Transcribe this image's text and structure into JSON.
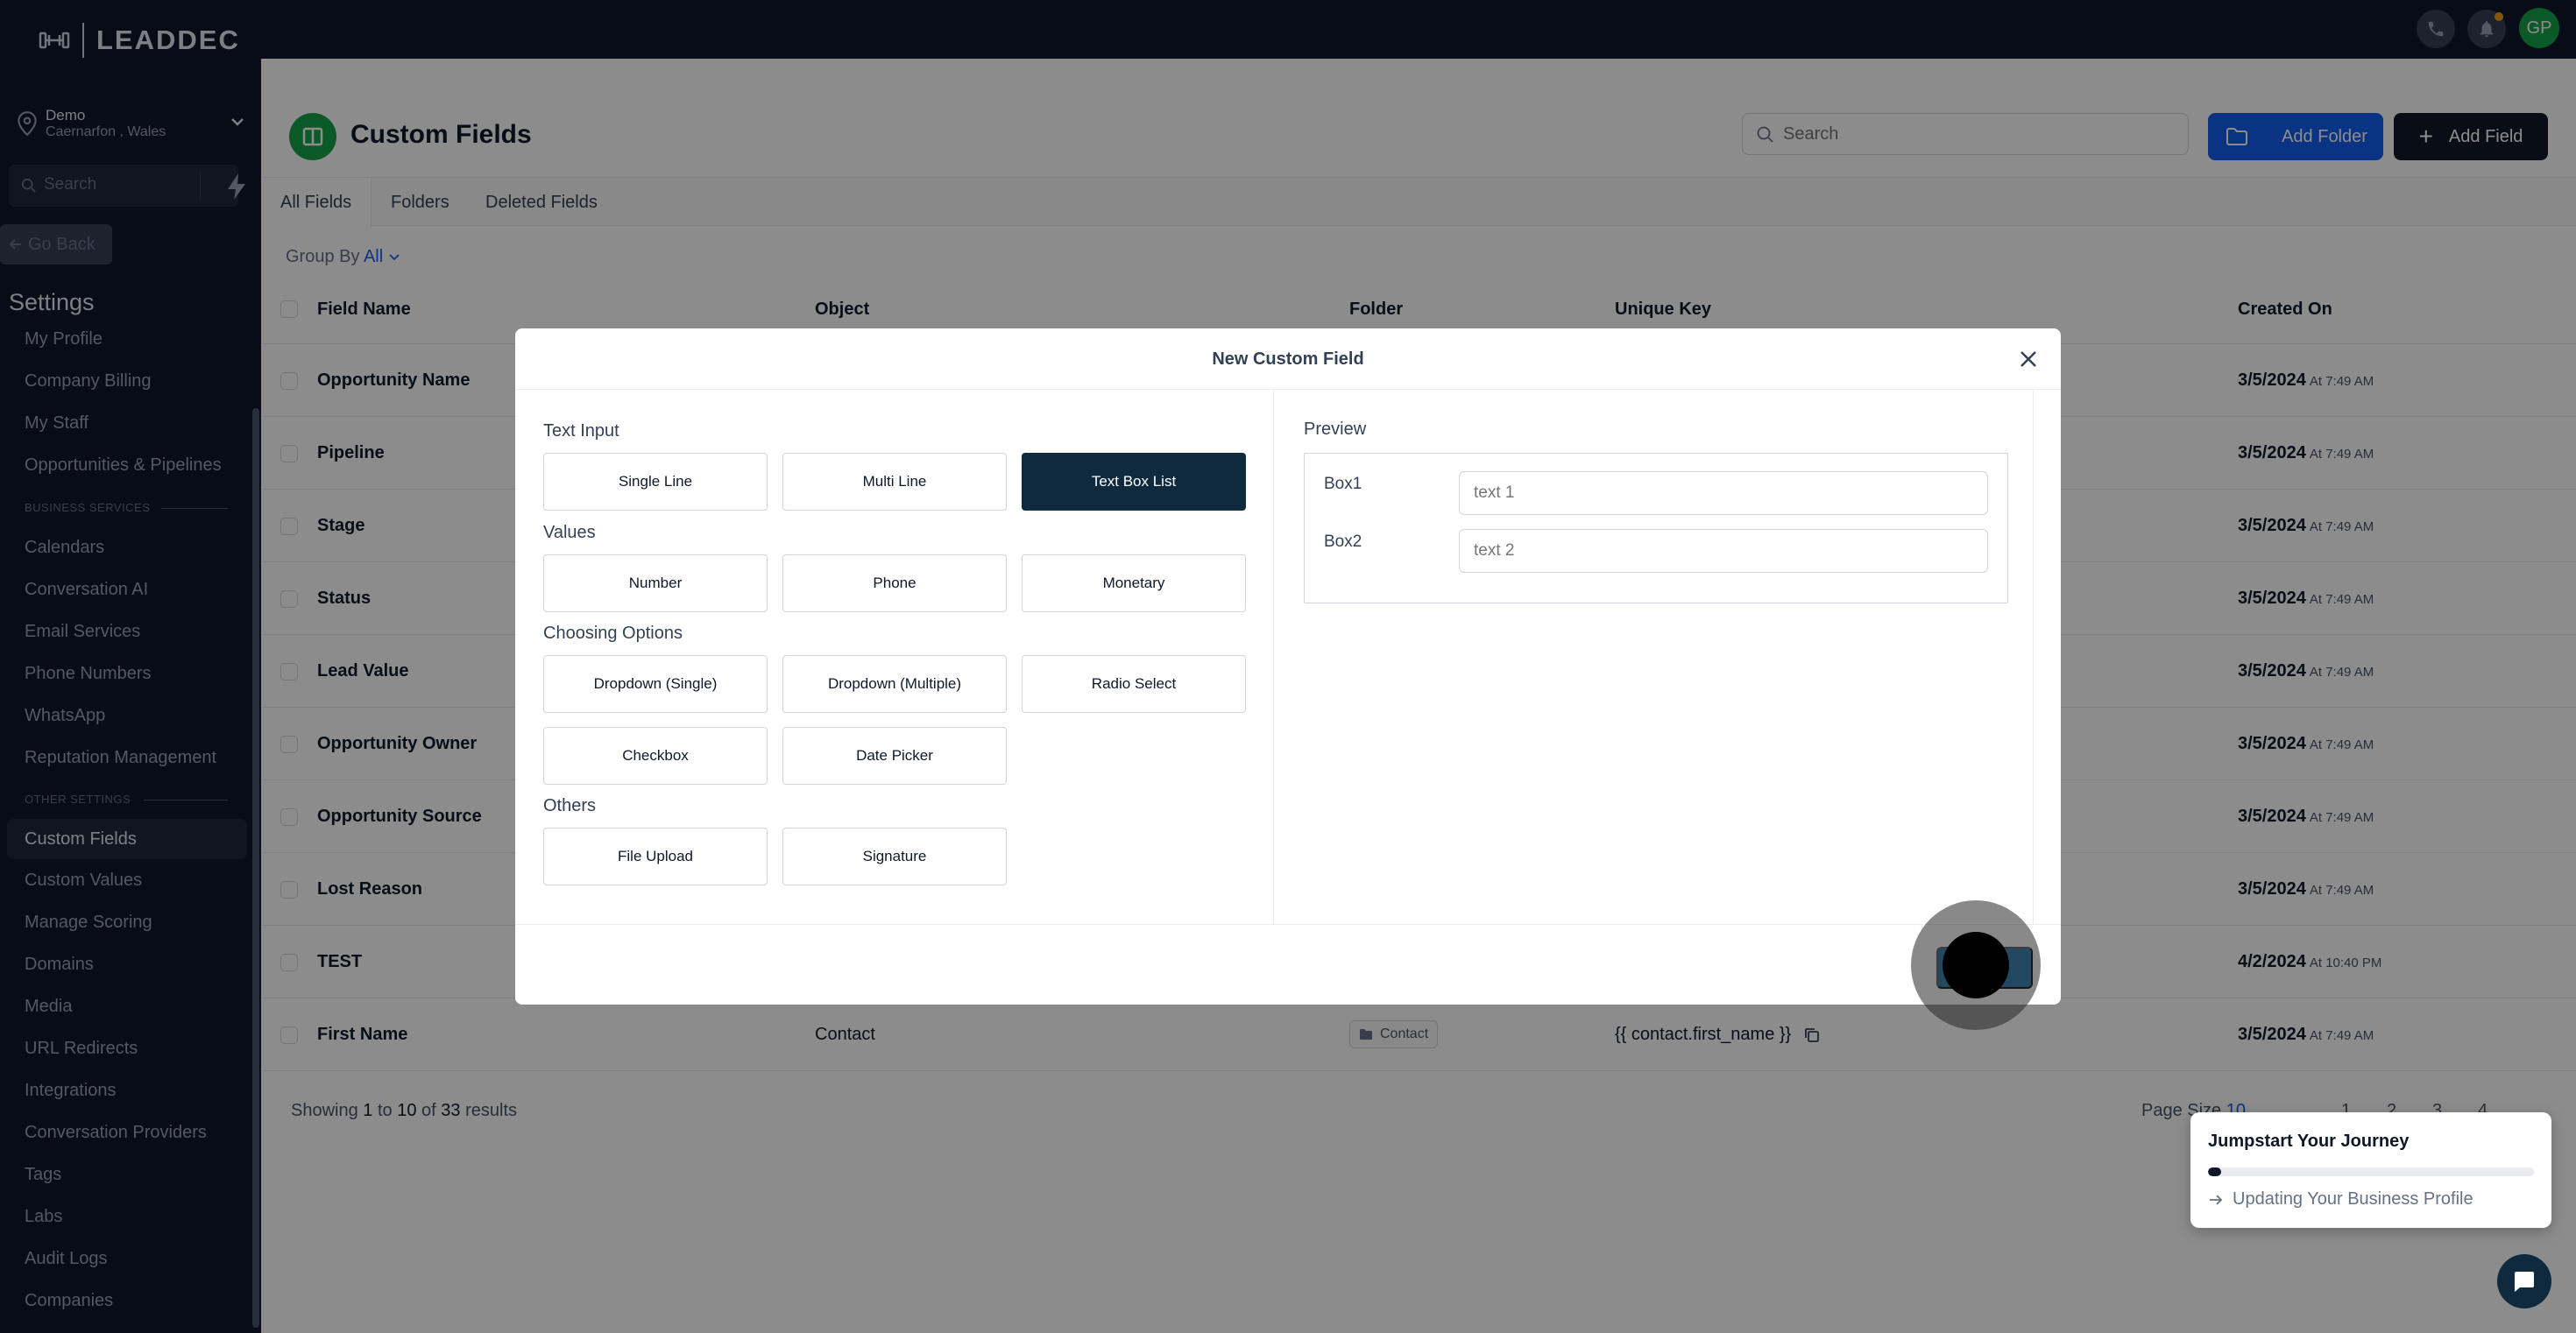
{
  "brand": {
    "logo_text": "LEADDEC"
  },
  "location": {
    "name": "Demo",
    "subtitle": "Caernarfon , Wales"
  },
  "sidebar": {
    "search_placeholder": "Search",
    "go_back": "Go Back",
    "settings_title": "Settings",
    "items_top": [
      "My Profile",
      "Company Billing",
      "My Staff",
      "Opportunities & Pipelines"
    ],
    "section_business": "BUSINESS SERVICES",
    "items_business": [
      "Calendars",
      "Conversation AI",
      "Email Services",
      "Phone Numbers",
      "WhatsApp",
      "Reputation Management"
    ],
    "section_other": "OTHER SETTINGS",
    "items_other": [
      "Custom Fields",
      "Custom Values",
      "Manage Scoring",
      "Domains",
      "Media",
      "URL Redirects",
      "Integrations",
      "Conversation Providers",
      "Tags",
      "Labs",
      "Audit Logs",
      "Companies"
    ]
  },
  "topbar": {
    "avatar_initials": "GP"
  },
  "page": {
    "title": "Custom Fields",
    "search_placeholder": "Search",
    "add_folder": "Add Folder",
    "add_field": "Add Field",
    "tabs": [
      "All Fields",
      "Folders",
      "Deleted Fields"
    ],
    "group_by_label": "Group By",
    "group_by_value": "All"
  },
  "table": {
    "headers": {
      "field_name": "Field Name",
      "object": "Object",
      "folder": "Folder",
      "unique_key": "Unique Key",
      "created_on": "Created On"
    },
    "rows": [
      {
        "name": "Opportunity Name",
        "date": "3/5/2024",
        "time": "At 7:49 AM"
      },
      {
        "name": "Pipeline",
        "date": "3/5/2024",
        "time": "At 7:49 AM"
      },
      {
        "name": "Stage",
        "date": "3/5/2024",
        "time": "At 7:49 AM"
      },
      {
        "name": "Status",
        "date": "3/5/2024",
        "time": "At 7:49 AM"
      },
      {
        "name": "Lead Value",
        "date": "3/5/2024",
        "time": "At 7:49 AM"
      },
      {
        "name": "Opportunity Owner",
        "date": "3/5/2024",
        "time": "At 7:49 AM"
      },
      {
        "name": "Opportunity Source",
        "date": "3/5/2024",
        "time": "At 7:49 AM"
      },
      {
        "name": "Lost Reason",
        "date": "3/5/2024",
        "time": "At 7:49 AM"
      },
      {
        "name": "TEST",
        "date": "4/2/2024",
        "time": "At 10:40 PM"
      },
      {
        "name": "First Name",
        "object": "Contact",
        "folder": "Contact",
        "key": "{{ contact.first_name }}",
        "date": "3/5/2024",
        "time": "At 7:49 AM"
      }
    ]
  },
  "pagination": {
    "showing_prefix": "Showing",
    "from": "1",
    "to_word": "to",
    "to": "10",
    "of_word": "of",
    "total": "33",
    "results_word": "results",
    "page_size_label": "Page Size",
    "page_size_value": "10",
    "pages": [
      "1",
      "2",
      "3",
      "4"
    ]
  },
  "modal": {
    "title": "New Custom Field",
    "groups": {
      "text_input": "Text Input",
      "values": "Values",
      "choosing_options": "Choosing Options",
      "others": "Others"
    },
    "types": {
      "single_line": "Single Line",
      "multi_line": "Multi Line",
      "text_box_list": "Text Box List",
      "number": "Number",
      "phone": "Phone",
      "monetary": "Monetary",
      "dropdown_single": "Dropdown (Single)",
      "dropdown_multiple": "Dropdown (Multiple)",
      "radio_select": "Radio Select",
      "checkbox": "Checkbox",
      "date_picker": "Date Picker",
      "file_upload": "File Upload",
      "signature": "Signature"
    },
    "selected_type": "Text Box List",
    "preview": {
      "label": "Preview",
      "box1_label": "Box1",
      "box1_placeholder": "text 1",
      "box2_label": "Box2",
      "box2_placeholder": "text 2"
    }
  },
  "journey": {
    "title": "Jumpstart Your Journey",
    "step": "Updating Your Business Profile",
    "progress_fraction": 0.02
  },
  "colors": {
    "sidebar_bg": "#0f172a",
    "accent_blue": "#155eef",
    "selected_type_bg": "#0f2a3f",
    "page_icon_green": "#16a34a"
  }
}
